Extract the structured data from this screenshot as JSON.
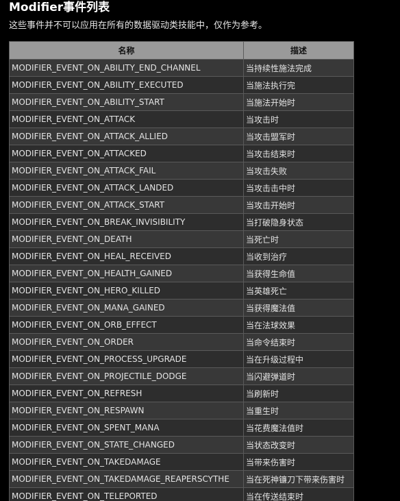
{
  "heading": "Modifier事件列表",
  "description": "这些事件并不可以应用在所有的数据驱动类技能中，仅作为参考。",
  "table": {
    "headers": [
      "名称",
      "描述"
    ],
    "rows": [
      [
        "MODIFIER_EVENT_ON_ABILITY_END_CHANNEL",
        "当持续性施法完成"
      ],
      [
        "MODIFIER_EVENT_ON_ABILITY_EXECUTED",
        "当施法执行完"
      ],
      [
        "MODIFIER_EVENT_ON_ABILITY_START",
        "当施法开始时"
      ],
      [
        "MODIFIER_EVENT_ON_ATTACK",
        "当攻击时"
      ],
      [
        "MODIFIER_EVENT_ON_ATTACK_ALLIED",
        "当攻击盟军时"
      ],
      [
        "MODIFIER_EVENT_ON_ATTACKED",
        "当攻击结束时"
      ],
      [
        "MODIFIER_EVENT_ON_ATTACK_FAIL",
        "当攻击失败"
      ],
      [
        "MODIFIER_EVENT_ON_ATTACK_LANDED",
        "当攻击击中时"
      ],
      [
        "MODIFIER_EVENT_ON_ATTACK_START",
        "当攻击开始时"
      ],
      [
        "MODIFIER_EVENT_ON_BREAK_INVISIBILITY",
        "当打破隐身状态"
      ],
      [
        "MODIFIER_EVENT_ON_DEATH",
        "当死亡时"
      ],
      [
        "MODIFIER_EVENT_ON_HEAL_RECEIVED",
        "当收到治疗"
      ],
      [
        "MODIFIER_EVENT_ON_HEALTH_GAINED",
        "当获得生命值"
      ],
      [
        "MODIFIER_EVENT_ON_HERO_KILLED",
        "当英雄死亡"
      ],
      [
        "MODIFIER_EVENT_ON_MANA_GAINED",
        "当获得魔法值"
      ],
      [
        "MODIFIER_EVENT_ON_ORB_EFFECT",
        "当在法球效果"
      ],
      [
        "MODIFIER_EVENT_ON_ORDER",
        "当命令结束时"
      ],
      [
        "MODIFIER_EVENT_ON_PROCESS_UPGRADE",
        "当在升级过程中"
      ],
      [
        "MODIFIER_EVENT_ON_PROJECTILE_DODGE",
        "当闪避弹道时"
      ],
      [
        "MODIFIER_EVENT_ON_REFRESH",
        "当刷新时"
      ],
      [
        "MODIFIER_EVENT_ON_RESPAWN",
        "当重生时"
      ],
      [
        "MODIFIER_EVENT_ON_SPENT_MANA",
        "当花费魔法值时"
      ],
      [
        "MODIFIER_EVENT_ON_STATE_CHANGED",
        "当状态改变时"
      ],
      [
        "MODIFIER_EVENT_ON_TAKEDAMAGE",
        "当带来伤害时"
      ],
      [
        "MODIFIER_EVENT_ON_TAKEDAMAGE_REAPERSCYTHE",
        "当在死神镰刀下带来伤害时"
      ],
      [
        "MODIFIER_EVENT_ON_TELEPORTED",
        "当在传送结束时"
      ]
    ]
  }
}
